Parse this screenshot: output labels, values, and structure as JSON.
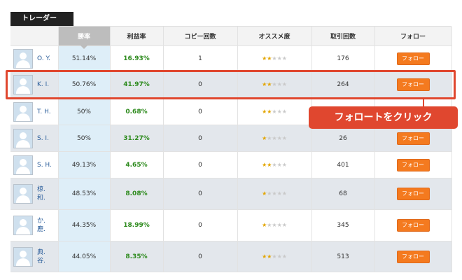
{
  "tab_label": "トレーダー",
  "headers": {
    "user": "",
    "win_rate": "勝率",
    "profit_rate": "利益率",
    "copy_count": "コピー回数",
    "recommend": "オススメ度",
    "trade_count": "取引回数",
    "follow": "フォロー"
  },
  "rows": [
    {
      "name_line1": "O. Y.",
      "name_line2": "",
      "win_rate": "51.14%",
      "profit_rate": "16.93%",
      "copies": "1",
      "stars_filled": 2,
      "stars_total": 5,
      "trades": "176",
      "follow_label": "フォロー"
    },
    {
      "name_line1": "K. I.",
      "name_line2": "",
      "win_rate": "50.76%",
      "profit_rate": "41.97%",
      "copies": "0",
      "stars_filled": 2,
      "stars_total": 5,
      "trades": "264",
      "follow_label": "フォロー"
    },
    {
      "name_line1": "T. H.",
      "name_line2": "",
      "win_rate": "50%",
      "profit_rate": "0.68%",
      "copies": "0",
      "stars_filled": 2,
      "stars_total": 5,
      "trades": "",
      "follow_label": ""
    },
    {
      "name_line1": "S. I.",
      "name_line2": "",
      "win_rate": "50%",
      "profit_rate": "31.27%",
      "copies": "0",
      "stars_filled": 1,
      "stars_total": 5,
      "trades": "26",
      "follow_label": "フォロー"
    },
    {
      "name_line1": "S. H.",
      "name_line2": "",
      "win_rate": "49.13%",
      "profit_rate": "4.65%",
      "copies": "0",
      "stars_filled": 2,
      "stars_total": 5,
      "trades": "401",
      "follow_label": "フォロー"
    },
    {
      "name_line1": "椋.",
      "name_line2": "和.",
      "win_rate": "48.53%",
      "profit_rate": "8.08%",
      "copies": "0",
      "stars_filled": 1,
      "stars_total": 5,
      "trades": "68",
      "follow_label": "フォロー"
    },
    {
      "name_line1": "か.",
      "name_line2": "鹿.",
      "win_rate": "44.35%",
      "profit_rate": "18.99%",
      "copies": "0",
      "stars_filled": 1,
      "stars_total": 5,
      "trades": "345",
      "follow_label": "フォロー"
    },
    {
      "name_line1": "典.",
      "name_line2": "谷.",
      "win_rate": "44.05%",
      "profit_rate": "8.35%",
      "copies": "0",
      "stars_filled": 2,
      "stars_total": 5,
      "trades": "513",
      "follow_label": "フォロー"
    }
  ],
  "callout_text": "フォロートをクリック",
  "colors": {
    "accent_orange": "#f47a1f",
    "highlight_red": "#e0472f",
    "profit_green": "#2e8b1e"
  }
}
